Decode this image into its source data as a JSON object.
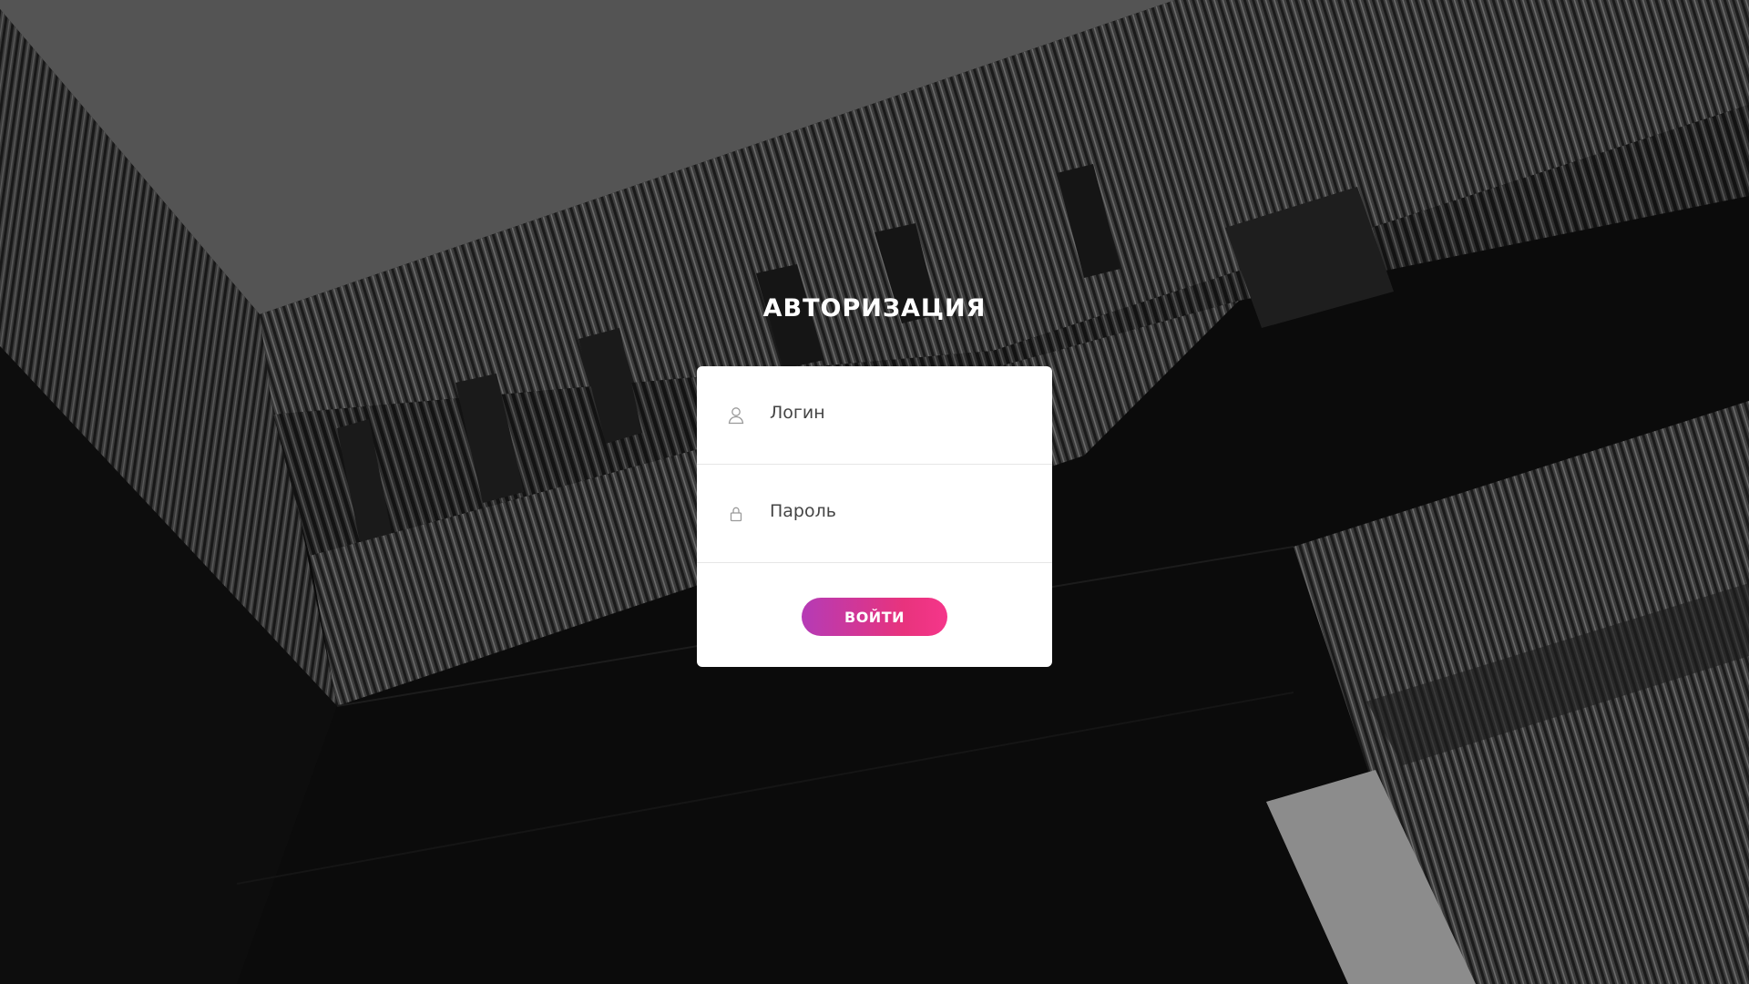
{
  "login": {
    "title": "АВТОРИЗАЦИЯ",
    "fields": {
      "login_label": "Логин",
      "password_label": "Пароль"
    },
    "submit_label": "ВОЙТИ",
    "icons": {
      "login_icon": "user-icon",
      "password_icon": "lock-icon"
    }
  },
  "colors": {
    "button_gradient_start": "#b53bb6",
    "button_gradient_end": "#f5368a",
    "card_background": "#ffffff",
    "title_color": "#ffffff"
  }
}
